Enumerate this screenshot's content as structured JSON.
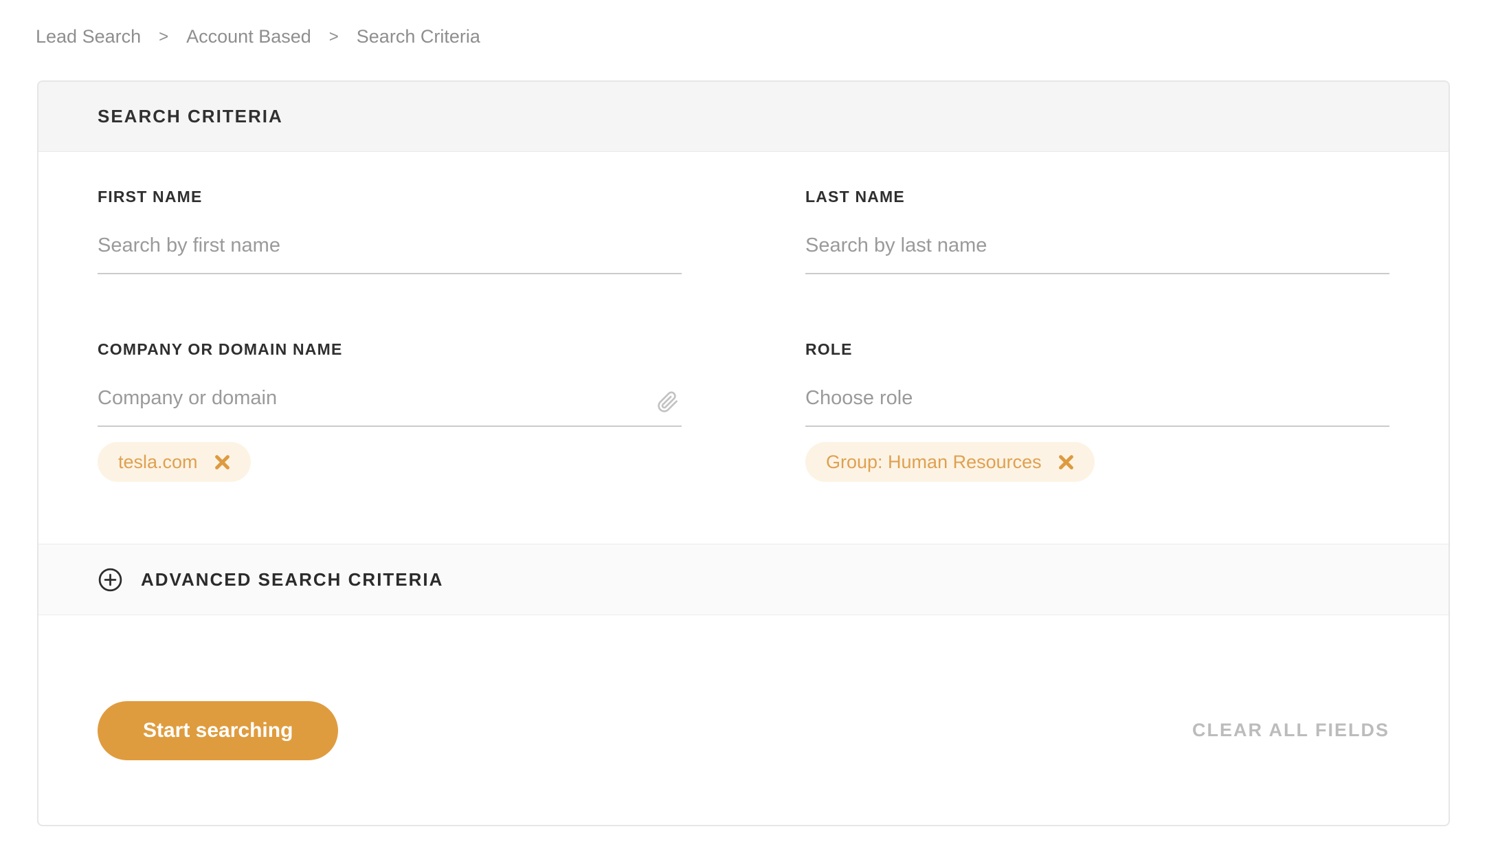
{
  "breadcrumb": {
    "separator": ">",
    "items": [
      {
        "label": "Lead Search"
      },
      {
        "label": "Account Based"
      },
      {
        "label": "Search Criteria"
      }
    ]
  },
  "card": {
    "header": {
      "title": "SEARCH CRITERIA"
    },
    "fields": {
      "first_name": {
        "label": "FIRST NAME",
        "placeholder": "Search by first name",
        "value": ""
      },
      "last_name": {
        "label": "LAST NAME",
        "placeholder": "Search by last name",
        "value": ""
      },
      "company": {
        "label": "COMPANY OR DOMAIN NAME",
        "placeholder": "Company or domain",
        "value": "",
        "icon": "paperclip-icon",
        "chips": [
          {
            "label": "tesla.com",
            "remove_icon": "close-icon"
          }
        ]
      },
      "role": {
        "label": "ROLE",
        "placeholder": "Choose role",
        "value": "",
        "chips": [
          {
            "label": "Group: Human Resources",
            "remove_icon": "close-icon"
          }
        ]
      }
    },
    "advanced": {
      "title": "ADVANCED SEARCH CRITERIA",
      "icon": "plus-circle-icon"
    },
    "footer": {
      "start_button_label": "Start searching",
      "clear_button_label": "CLEAR ALL FIELDS"
    }
  },
  "colors": {
    "accent_orange": "#df9c3e",
    "chip_background": "#fcf3e4",
    "chip_text": "#dfa050",
    "chip_close": "#dd9a3e",
    "header_background": "#f5f5f5",
    "advanced_background": "#fafafa",
    "breadcrumb_text": "#8e8e8e",
    "label_text": "#2f2f2f",
    "placeholder_text": "#9a9a9a",
    "field_underline": "#cbcbcb",
    "clear_text": "#bcbcbc"
  }
}
